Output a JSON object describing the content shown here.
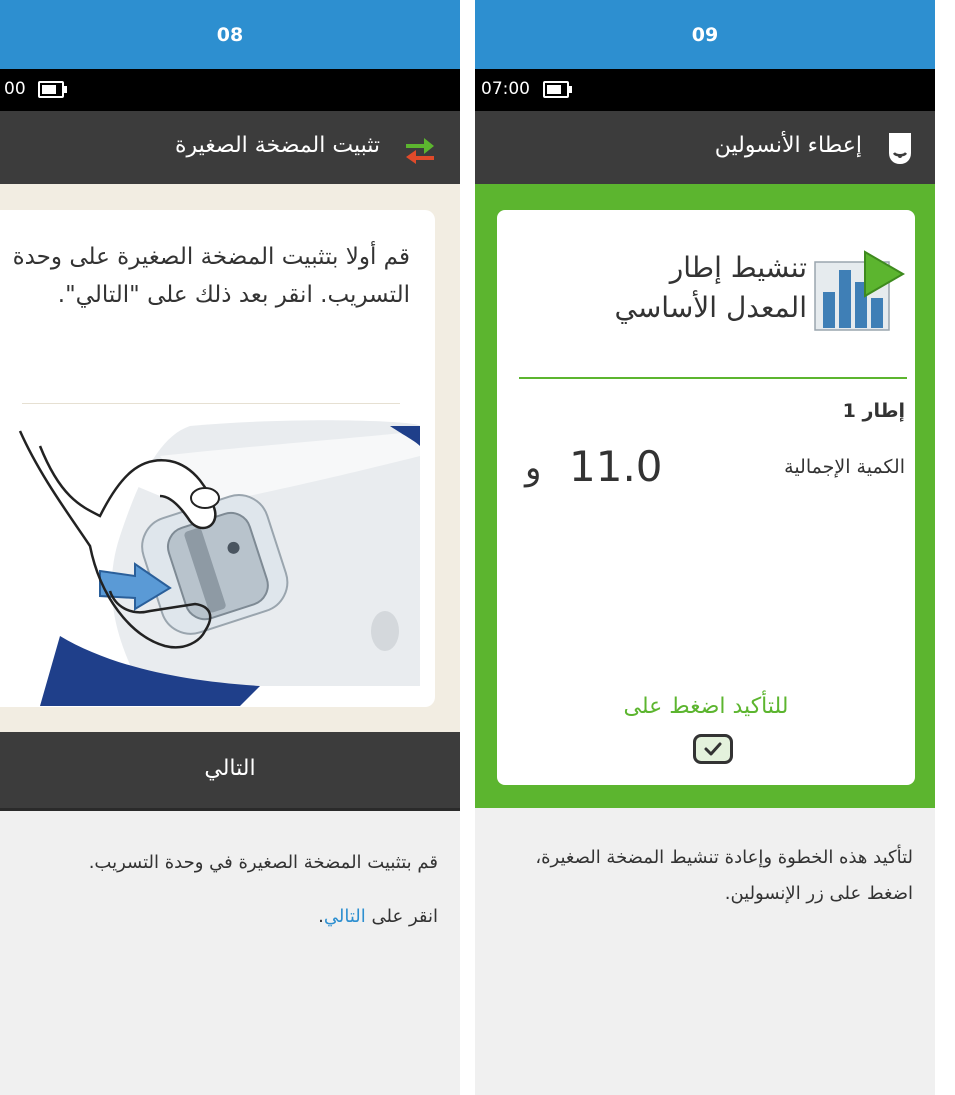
{
  "left": {
    "step": "08",
    "status_time": "00",
    "title": "تثبيت المضخة الصغيرة",
    "instruction": "قم أولا بتثبيت المضخة الصغيرة على وحدة التسريب. انقر بعد ذلك على \"التالي\".",
    "image_icon": "patch-pump-attach-illustration",
    "title_icon": "swap-arrows-icon",
    "next_button": "التالي",
    "description": {
      "line1": "قم بتثبيت المضخة الصغيرة في وحدة التسريب.",
      "line2_prefix": "انقر على ",
      "line2_link": "التالي",
      "line2_suffix": "."
    }
  },
  "right": {
    "step": "09",
    "status_time": "07:00",
    "title": "إعطاء الأنسولين",
    "title_icon": "insulin-pump-icon",
    "card": {
      "heading_line1": "تنشيط إطار",
      "heading_line2": "المعدل الأساسي",
      "heading_icon": "basal-rate-play-icon",
      "frame_label": "إطار 1",
      "total_label": "الكمية الإجمالية",
      "total_value": "11.0",
      "total_unit": "و",
      "confirm_text": "للتأكيد اضغط على",
      "confirm_icon": "checkmark-icon"
    },
    "description": "لتأكيد هذه الخطوة وإعادة تنشيط المضخة الصغيرة، اضغط على زر الإنسولين."
  },
  "colors": {
    "header_blue": "#2d8fd0",
    "bar_dark": "#3c3c3c",
    "confirm_green": "#5cb52f",
    "screen_beige": "#f2ede2"
  }
}
